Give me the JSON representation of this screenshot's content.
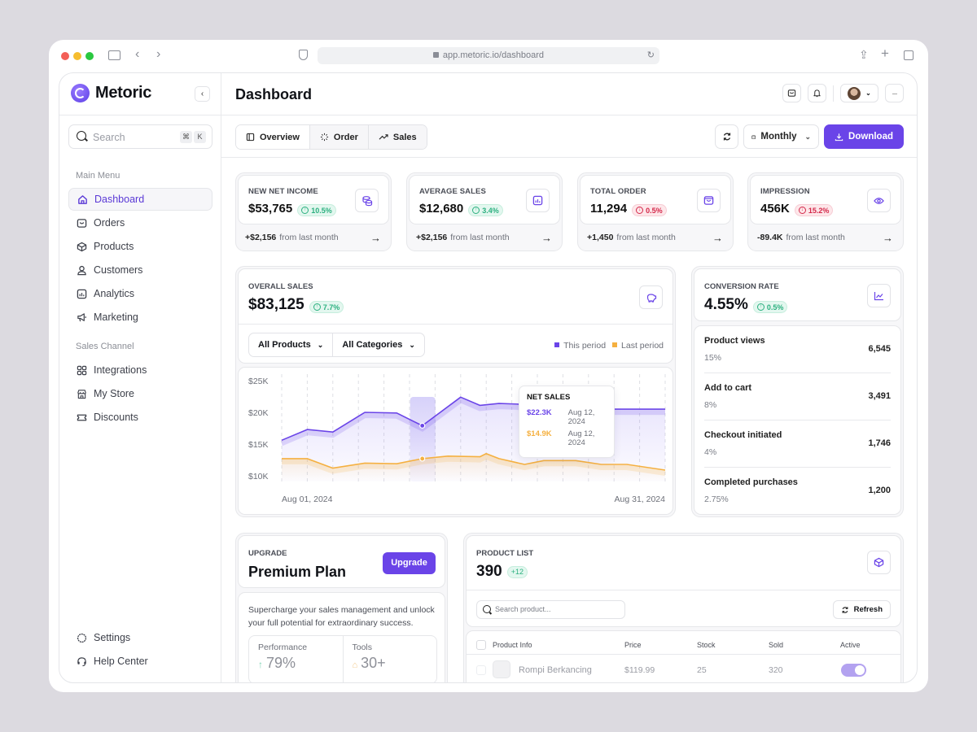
{
  "browser": {
    "url": "app.metoric.io/dashboard",
    "traffic_lights": [
      "#f35f57",
      "#f6bd2f",
      "#2ac840"
    ]
  },
  "brand": {
    "name": "Metoric",
    "accent": "#6a44e8"
  },
  "sidebar": {
    "search_placeholder": "Search",
    "shortcut_keys": [
      "⌘",
      "K"
    ],
    "main_menu_label": "Main Menu",
    "main_menu": [
      {
        "label": "Dashboard",
        "icon": "home-icon",
        "active": true
      },
      {
        "label": "Orders",
        "icon": "orders-icon",
        "active": false
      },
      {
        "label": "Products",
        "icon": "box-icon",
        "active": false
      },
      {
        "label": "Customers",
        "icon": "user-icon",
        "active": false
      },
      {
        "label": "Analytics",
        "icon": "analytics-icon",
        "active": false
      },
      {
        "label": "Marketing",
        "icon": "megaphone-icon",
        "active": false
      }
    ],
    "sales_channel_label": "Sales Channel",
    "sales_channel": [
      {
        "label": "Integrations",
        "icon": "grid-icon"
      },
      {
        "label": "My Store",
        "icon": "store-icon"
      },
      {
        "label": "Discounts",
        "icon": "ticket-icon"
      }
    ],
    "bottom": [
      {
        "label": "Settings",
        "icon": "gear-icon"
      },
      {
        "label": "Help Center",
        "icon": "headset-icon"
      }
    ]
  },
  "header": {
    "title": "Dashboard",
    "more_label": "···"
  },
  "toolbar": {
    "tabs": [
      {
        "label": "Overview",
        "icon": "sidebar-icon",
        "active": true
      },
      {
        "label": "Order",
        "icon": "loader-icon",
        "active": false
      },
      {
        "label": "Sales",
        "icon": "trend-icon",
        "active": false
      }
    ],
    "period_select": "Monthly",
    "download_label": "Download"
  },
  "kpis": [
    {
      "label": "NEW NET INCOME",
      "value": "$53,765",
      "change": "10.5%",
      "direction": "up",
      "icon": "coins-icon",
      "delta": "+$2,156",
      "delta_text": "from last month"
    },
    {
      "label": "AVERAGE SALES",
      "value": "$12,680",
      "change": "3.4%",
      "direction": "up",
      "icon": "bar-chart-icon",
      "delta": "+$2,156",
      "delta_text": "from last month"
    },
    {
      "label": "TOTAL ORDER",
      "value": "11,294",
      "change": "0.5%",
      "direction": "down",
      "icon": "bag-icon",
      "delta": "+1,450",
      "delta_text": "from last month"
    },
    {
      "label": "IMPRESSION",
      "value": "456K",
      "change": "15.2%",
      "direction": "down",
      "icon": "eye-icon",
      "delta": "-89.4K",
      "delta_text": "from last month"
    }
  ],
  "overall_sales": {
    "label": "OVERALL SALES",
    "value": "$83,125",
    "change": "7.7%",
    "filters": [
      "All Products",
      "All Categories"
    ],
    "legend": [
      {
        "label": "This period",
        "color": "#6a44e8"
      },
      {
        "label": "Last period",
        "color": "#f5b040"
      }
    ],
    "tooltip": {
      "title": "NET SALES",
      "rows": [
        {
          "value": "$22.3K",
          "date": "Aug 12, 2024",
          "color": "#6a44e8"
        },
        {
          "value": "$14.9K",
          "date": "Aug 12, 2024",
          "color": "#f5b040"
        }
      ]
    }
  },
  "chart_data": {
    "type": "area",
    "title": "OVERALL SALES",
    "xlabel": "",
    "ylabel": "",
    "x_tick_labels": [
      "Aug 01, 2024",
      "Aug 31, 2024"
    ],
    "y_tick_labels": [
      "$25K",
      "$20K",
      "$15K",
      "$10K"
    ],
    "ylim": [
      8000,
      25000
    ],
    "x_range": [
      1,
      31
    ],
    "grid": "vertical-dashed",
    "legend_position": "top-right",
    "highlight_day": 12,
    "series": [
      {
        "name": "This period",
        "color": "#6a44e8",
        "x": [
          1,
          3,
          5,
          7.5,
          10,
          12,
          15,
          16.5,
          18,
          19.5,
          23,
          25,
          26.5,
          29,
          31
        ],
        "values": [
          15600,
          17300,
          16900,
          20000,
          19900,
          17900,
          22400,
          21100,
          21400,
          21300,
          18500,
          16500,
          20500,
          20500,
          20500
        ]
      },
      {
        "name": "Last period",
        "color": "#f5b040",
        "x": [
          1,
          3,
          5,
          7.5,
          10,
          12,
          14,
          16.5,
          17,
          18,
          20,
          21.5,
          24,
          26,
          28,
          31
        ],
        "values": [
          12700,
          12700,
          11200,
          12000,
          11900,
          12700,
          13100,
          13000,
          13500,
          12700,
          11800,
          12400,
          12400,
          11800,
          11800,
          10900
        ]
      }
    ]
  },
  "conversion": {
    "label": "CONVERSION RATE",
    "value": "4.55%",
    "change": "0.5%",
    "rows": [
      {
        "name": "Product views",
        "pct": "15%",
        "value": "6,545"
      },
      {
        "name": "Add to cart",
        "pct": "8%",
        "value": "3,491"
      },
      {
        "name": "Checkout initiated",
        "pct": "4%",
        "value": "1,746"
      },
      {
        "name": "Completed purchases",
        "pct": "2.75%",
        "value": "1,200"
      }
    ]
  },
  "upgrade": {
    "label": "UPGRADE",
    "title": "Premium Plan",
    "button": "Upgrade",
    "description": "Supercharge your sales management and unlock your full potential for extraordinary success.",
    "stats": [
      {
        "label": "Performance",
        "value": "79%",
        "icon": "arrow-up-icon"
      },
      {
        "label": "Tools",
        "value": "30+",
        "icon": "lock-icon"
      }
    ]
  },
  "product_list": {
    "label": "PRODUCT LIST",
    "count": "390",
    "badge": "+12",
    "search_placeholder": "Search product...",
    "refresh_label": "Refresh",
    "columns": [
      "Product Info",
      "Price",
      "Stock",
      "Sold",
      "Active"
    ],
    "rows": [
      {
        "name": "Rompi Berkancing",
        "price": "$119.99",
        "stock": "25",
        "sold": "320",
        "active": true
      }
    ]
  }
}
